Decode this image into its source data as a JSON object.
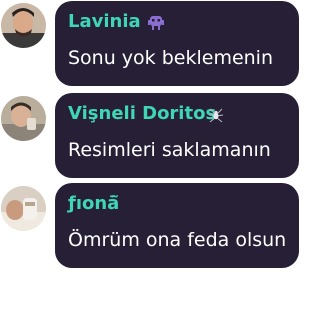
{
  "messages": [
    {
      "name": "Lavinia",
      "text": "Sonu yok beklemenin",
      "badge_icon": "alien-monster-icon",
      "avatar_icon": "user-photo-avatar"
    },
    {
      "name": "Vişneli Doritos",
      "text": "Resimleri saklamanın",
      "badge_icon": "spider-icon",
      "avatar_icon": "user-photo-avatar"
    },
    {
      "name": "ƒıonā̃",
      "text": "Ömrüm ona feda olsun",
      "badge_icon": "",
      "avatar_icon": "user-photo-avatar"
    }
  ],
  "colors": {
    "bubble_background": "#261f36",
    "username": "#3fd6b6",
    "message_text": "#ffffff",
    "page_background": "#ffffff"
  }
}
